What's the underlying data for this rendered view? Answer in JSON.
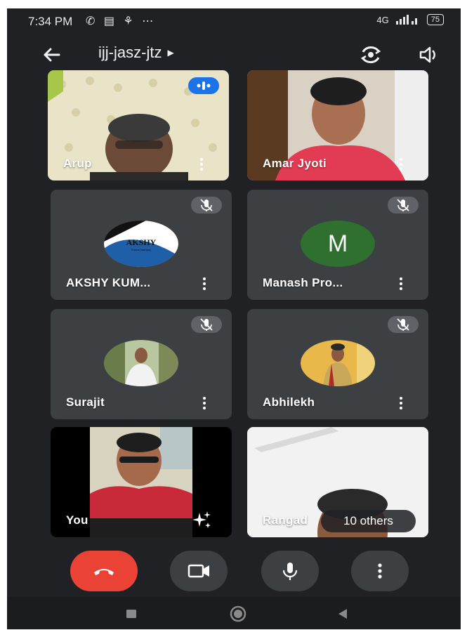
{
  "status_bar": {
    "time": "7:34 PM",
    "notif_icons": "✆ ▤ ⚘ ⋯",
    "network": "4G",
    "battery": "75"
  },
  "header": {
    "meeting_code": "ijj-jasz-jtz"
  },
  "participants": [
    {
      "name": "Arup",
      "state": "speaking"
    },
    {
      "name": "Amar Jyoti",
      "state": "video"
    },
    {
      "name": "AKSHY KUM...",
      "state": "muted",
      "avatar_text": "AKSHY",
      "avatar_subtext": "Kumar kashyap"
    },
    {
      "name": "Manash Pro...",
      "state": "muted",
      "avatar_letter": "M"
    },
    {
      "name": "Surajit",
      "state": "muted"
    },
    {
      "name": "Abhilekh",
      "state": "muted"
    },
    {
      "name": "You",
      "state": "self"
    },
    {
      "name": "Rangad",
      "state": "video",
      "overflow_label": "10 others"
    }
  ],
  "controls": [
    "end-call",
    "camera",
    "microphone",
    "more-options"
  ],
  "colors": {
    "end_call": "#ea4335",
    "active_speaker": "#1a73e8",
    "tile": "#3c4043",
    "background": "#202124"
  }
}
